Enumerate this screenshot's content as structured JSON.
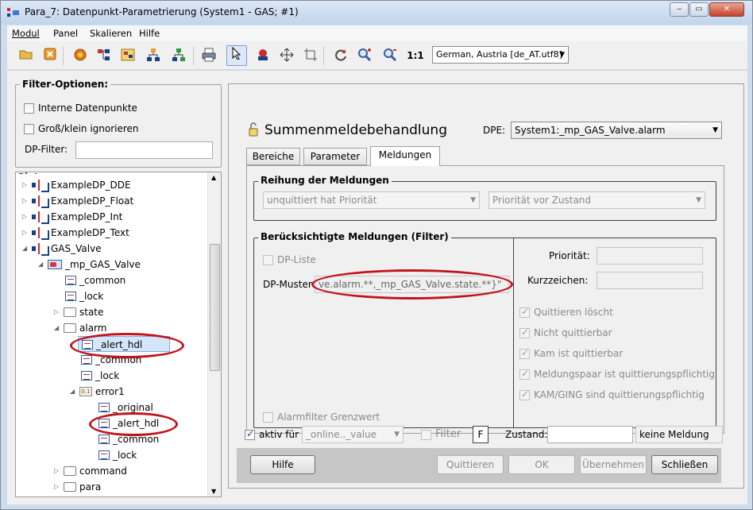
{
  "window": {
    "title": "Para_7: Datenpunkt-Parametrierung (System1 - GAS; #1)",
    "controls": {
      "minimize": "‒",
      "maximize": "▭",
      "close": "✕"
    }
  },
  "menubar": [
    "Modul",
    "Panel",
    "Skalieren",
    "Hilfe"
  ],
  "toolbar": {
    "language": "German, Austria [de_AT.utf8]",
    "icons": [
      "open-folder-icon",
      "exit-icon",
      "settings-gear-icon",
      "datapoint-structure-icon",
      "select-type-icon",
      "hierarchy-icon",
      "hierarchy-green-icon",
      "print-icon",
      "pointer-icon",
      "tools-icon",
      "move-icon",
      "crop-icon",
      "refresh-icon",
      "zoom-in-icon",
      "zoom-out-icon",
      "zoom-reset-icon"
    ],
    "zoom_reset_label": "1:1"
  },
  "filter": {
    "title": "Filter-Optionen:",
    "internal_dp_label": "Interne Datenpunkte",
    "case_insensitive_label": "Groß/klein ignorieren",
    "dp_filter_label": "DP-Filter:",
    "dp_filter_value": ""
  },
  "tree": {
    "rows": [
      {
        "label": "ExampleDP_DDE"
      },
      {
        "label": "ExampleDP_Float"
      },
      {
        "label": "ExampleDP_Int"
      },
      {
        "label": "ExampleDP_Text"
      },
      {
        "label": "GAS_Valve"
      },
      {
        "label": "_mp_GAS_Valve"
      },
      {
        "label": "_common"
      },
      {
        "label": "_lock"
      },
      {
        "label": "state"
      },
      {
        "label": "alarm"
      },
      {
        "label": "_alert_hdl"
      },
      {
        "label": "_common"
      },
      {
        "label": "_lock"
      },
      {
        "label": "error1"
      },
      {
        "label": "_original"
      },
      {
        "label": "_alert_hdl"
      },
      {
        "label": "_common"
      },
      {
        "label": "_lock"
      },
      {
        "label": "command"
      },
      {
        "label": "para"
      }
    ]
  },
  "panel": {
    "title": "Summenmeldebehandlung",
    "dpe_label": "DPE:",
    "dpe_value": "System1:_mp_GAS_Valve.alarm",
    "tabs": [
      "Bereiche",
      "Parameter",
      "Meldungen"
    ],
    "ordering": {
      "title": "Reihung der Meldungen",
      "left_option": "unquittiert hat Priorität",
      "right_option": "Priorität vor Zustand"
    },
    "filter": {
      "title": "Berücksichtigte Meldungen (Filter)",
      "dp_list_label": "DP-Liste",
      "dp_pattern_label": "DP-Muster:",
      "dp_pattern_value": "ve.alarm.**,_mp_GAS_Valve.state.**}\"",
      "alarm_filter_label": "Alarmfilter Grenzwert",
      "priority_label": "Priorität:",
      "shortcut_label": "Kurzzeichen:",
      "checks": [
        "Quittieren löscht",
        "Nicht quittierbar",
        "Kam ist quittierbar",
        "Meldungspaar ist quittierungspflichtig",
        "KAM/GING sind quittierungspflichtig"
      ]
    },
    "active_for_label": "aktiv für",
    "active_value": "_online.._value",
    "filter_label": "Filter",
    "filter_button": "F",
    "state_label": "Zustand:",
    "state_value": "keine Meldung"
  },
  "buttons": {
    "help": "Hilfe",
    "acknowledge": "Quittieren",
    "ok": "OK",
    "apply": "Übernehmen",
    "close": "Schließen"
  },
  "colors": {
    "highlight_ring": "#c0141c",
    "selection": "#d6e6fa"
  }
}
